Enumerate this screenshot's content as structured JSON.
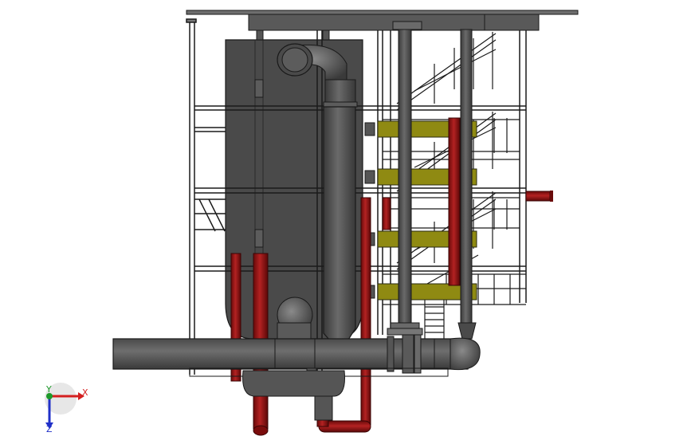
{
  "scene": {
    "background": "#ffffff",
    "colors": {
      "steel": "#595959",
      "steel_dark": "#3e3e3e",
      "steel_light": "#8a8a8a",
      "frame_line": "#1a1a1a",
      "hot_pipe": "#8b0f10",
      "hot_pipe_light": "#c03a3a",
      "heat_exchanger": "#8f8a12",
      "plate": "#6b6b6b"
    }
  },
  "triad": {
    "x_label": "X",
    "y_label": "Y",
    "z_label": "Z",
    "x_color": "#d42020",
    "y_color": "#1e9a2a",
    "z_color": "#2030c8"
  }
}
